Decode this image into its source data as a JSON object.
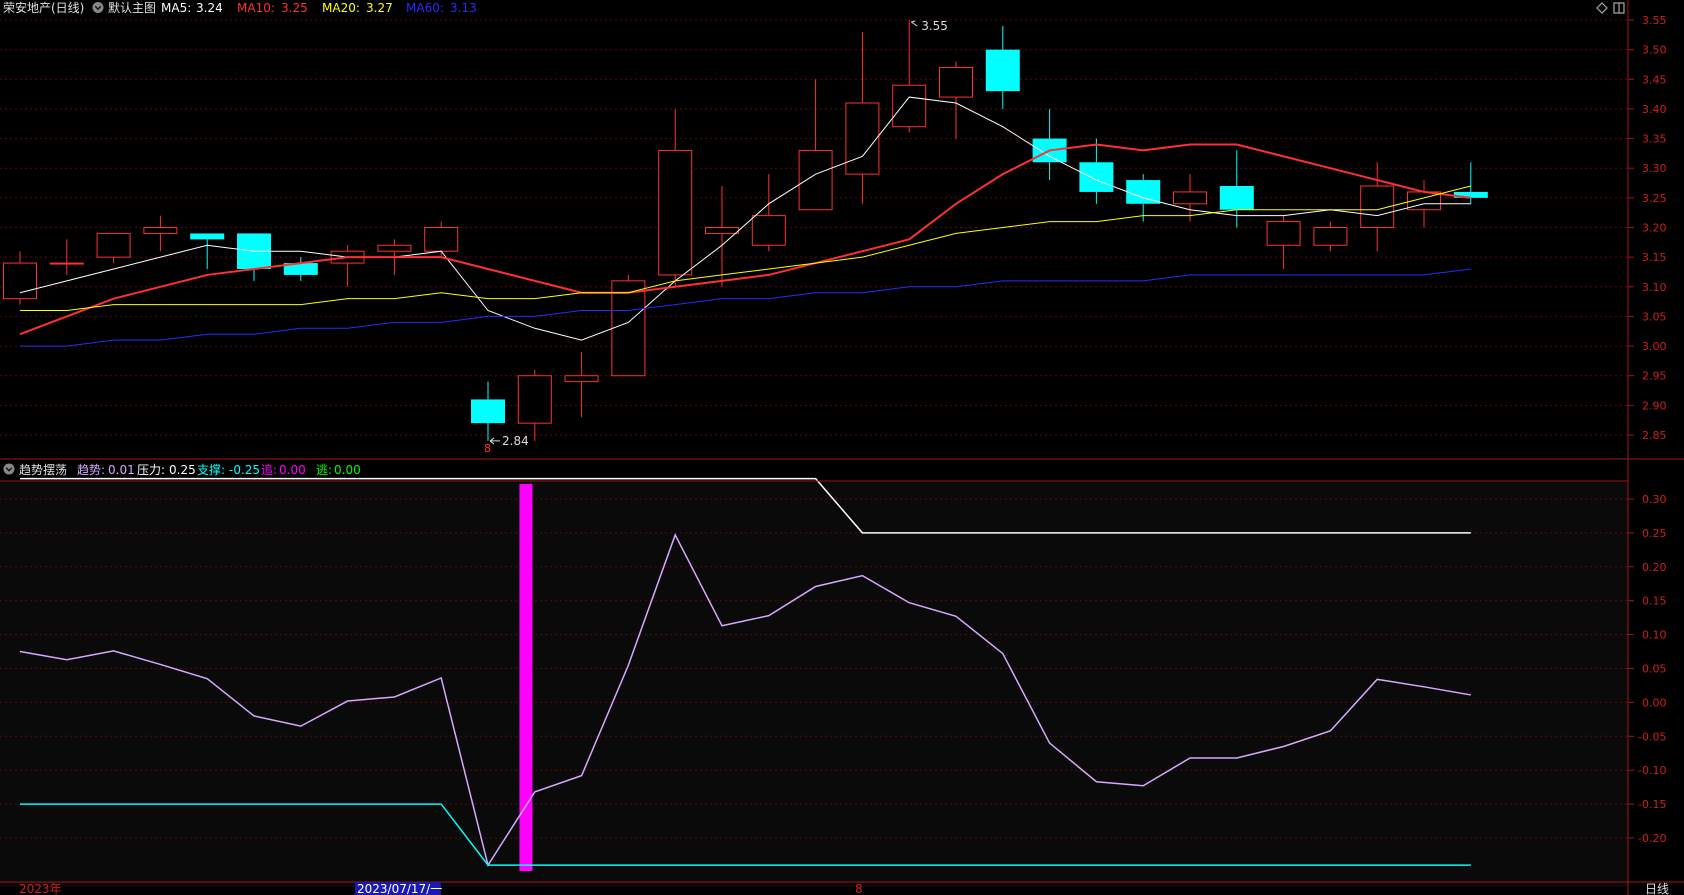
{
  "header": {
    "title": "荣安地产(日线)",
    "main_label": "默认主图",
    "ma": [
      {
        "label": "MA5:",
        "value": "3.24",
        "color": "#ffffff"
      },
      {
        "label": "MA10:",
        "value": "3.25",
        "color": "#ff3030"
      },
      {
        "label": "MA20:",
        "value": "3.27",
        "color": "#ffff00"
      },
      {
        "label": "MA60:",
        "value": "3.13",
        "color": "#2a2aff"
      }
    ]
  },
  "sub_header": {
    "title": "趋势摆荡",
    "items": [
      {
        "label": "趋势:",
        "value": "0.01",
        "color": "#d7a8ff"
      },
      {
        "label": "压力:",
        "value": "0.25",
        "color": "#ffffff"
      },
      {
        "label": "支撑:",
        "value": "-0.25",
        "color": "#00ffff"
      },
      {
        "label": "追:",
        "value": "0.00",
        "color": "#ff00ff"
      },
      {
        "label": "逃:",
        "value": "0.00",
        "color": "#00ff00"
      }
    ]
  },
  "footer": {
    "left": "2023年",
    "date": "2023/07/17/一",
    "mid": "8",
    "right": "日线"
  },
  "chart_data": [
    {
      "type": "candlestick",
      "title": "荣安地产(日线)",
      "ylim": [
        2.82,
        3.57
      ],
      "y_ticks": [
        "3.55",
        "3.50",
        "3.45",
        "3.40",
        "3.35",
        "3.30",
        "3.25",
        "3.20",
        "3.15",
        "3.10",
        "3.05",
        "3.00",
        "2.95",
        "2.90",
        "2.85"
      ],
      "high_annotation": "3.55",
      "low_annotation": "2.84",
      "low_marker": "8",
      "candles": [
        {
          "o": 3.08,
          "h": 3.16,
          "l": 3.07,
          "c": 3.14
        },
        {
          "o": 3.14,
          "h": 3.18,
          "l": 3.12,
          "c": 3.14
        },
        {
          "o": 3.15,
          "h": 3.19,
          "l": 3.14,
          "c": 3.19
        },
        {
          "o": 3.19,
          "h": 3.22,
          "l": 3.16,
          "c": 3.2
        },
        {
          "o": 3.19,
          "h": 3.19,
          "l": 3.13,
          "c": 3.18
        },
        {
          "o": 3.19,
          "h": 3.19,
          "l": 3.11,
          "c": 3.13
        },
        {
          "o": 3.14,
          "h": 3.15,
          "l": 3.11,
          "c": 3.12
        },
        {
          "o": 3.14,
          "h": 3.17,
          "l": 3.1,
          "c": 3.16
        },
        {
          "o": 3.16,
          "h": 3.18,
          "l": 3.12,
          "c": 3.17
        },
        {
          "o": 3.16,
          "h": 3.21,
          "l": 3.15,
          "c": 3.2
        },
        {
          "o": 2.91,
          "h": 2.94,
          "l": 2.84,
          "c": 2.87
        },
        {
          "o": 2.87,
          "h": 2.96,
          "l": 2.84,
          "c": 2.95
        },
        {
          "o": 2.94,
          "h": 2.99,
          "l": 2.88,
          "c": 2.95
        },
        {
          "o": 2.95,
          "h": 3.12,
          "l": 2.95,
          "c": 3.11
        },
        {
          "o": 3.12,
          "h": 3.4,
          "l": 3.1,
          "c": 3.33
        },
        {
          "o": 3.19,
          "h": 3.27,
          "l": 3.1,
          "c": 3.2
        },
        {
          "o": 3.17,
          "h": 3.29,
          "l": 3.16,
          "c": 3.22
        },
        {
          "o": 3.23,
          "h": 3.45,
          "l": 3.23,
          "c": 3.33
        },
        {
          "o": 3.29,
          "h": 3.53,
          "l": 3.24,
          "c": 3.41
        },
        {
          "o": 3.37,
          "h": 3.55,
          "l": 3.36,
          "c": 3.44
        },
        {
          "o": 3.42,
          "h": 3.48,
          "l": 3.35,
          "c": 3.47
        },
        {
          "o": 3.5,
          "h": 3.54,
          "l": 3.4,
          "c": 3.43
        },
        {
          "o": 3.35,
          "h": 3.4,
          "l": 3.28,
          "c": 3.31
        },
        {
          "o": 3.31,
          "h": 3.35,
          "l": 3.24,
          "c": 3.26
        },
        {
          "o": 3.28,
          "h": 3.29,
          "l": 3.21,
          "c": 3.24
        },
        {
          "o": 3.24,
          "h": 3.29,
          "l": 3.21,
          "c": 3.26
        },
        {
          "o": 3.27,
          "h": 3.33,
          "l": 3.2,
          "c": 3.23
        },
        {
          "o": 3.17,
          "h": 3.22,
          "l": 3.13,
          "c": 3.21
        },
        {
          "o": 3.17,
          "h": 3.21,
          "l": 3.16,
          "c": 3.2
        },
        {
          "o": 3.2,
          "h": 3.31,
          "l": 3.16,
          "c": 3.27
        },
        {
          "o": 3.23,
          "h": 3.28,
          "l": 3.2,
          "c": 3.26
        },
        {
          "o": 3.26,
          "h": 3.31,
          "l": 3.24,
          "c": 3.25
        }
      ],
      "series": [
        {
          "name": "MA5",
          "color": "#ffffff",
          "width": 1,
          "values": [
            3.09,
            3.11,
            3.13,
            3.15,
            3.17,
            3.16,
            3.16,
            3.15,
            3.15,
            3.16,
            3.06,
            3.03,
            3.01,
            3.04,
            3.11,
            3.17,
            3.24,
            3.29,
            3.32,
            3.42,
            3.41,
            3.37,
            3.32,
            3.28,
            3.25,
            3.23,
            3.22,
            3.22,
            3.23,
            3.22,
            3.24,
            3.24
          ]
        },
        {
          "name": "MA10",
          "color": "#ff3030",
          "width": 2,
          "values": [
            3.02,
            3.05,
            3.08,
            3.1,
            3.12,
            3.13,
            3.14,
            3.15,
            3.15,
            3.15,
            3.13,
            3.11,
            3.09,
            3.09,
            3.1,
            3.11,
            3.12,
            3.14,
            3.16,
            3.18,
            3.24,
            3.29,
            3.33,
            3.34,
            3.33,
            3.34,
            3.34,
            3.32,
            3.3,
            3.28,
            3.26,
            3.25
          ]
        },
        {
          "name": "MA20",
          "color": "#ffff00",
          "width": 1,
          "values": [
            3.06,
            3.06,
            3.07,
            3.07,
            3.07,
            3.07,
            3.07,
            3.08,
            3.08,
            3.09,
            3.08,
            3.08,
            3.09,
            3.09,
            3.11,
            3.12,
            3.13,
            3.14,
            3.15,
            3.17,
            3.19,
            3.2,
            3.21,
            3.21,
            3.22,
            3.22,
            3.23,
            3.23,
            3.23,
            3.23,
            3.25,
            3.27
          ]
        },
        {
          "name": "MA60",
          "color": "#2a2aff",
          "width": 1,
          "values": [
            3.0,
            3.0,
            3.01,
            3.01,
            3.02,
            3.02,
            3.03,
            3.03,
            3.04,
            3.04,
            3.05,
            3.05,
            3.06,
            3.06,
            3.07,
            3.08,
            3.08,
            3.09,
            3.09,
            3.1,
            3.1,
            3.11,
            3.11,
            3.11,
            3.11,
            3.12,
            3.12,
            3.12,
            3.12,
            3.12,
            3.12,
            3.13
          ]
        }
      ]
    },
    {
      "type": "line",
      "title": "趋势摆荡",
      "ylim": [
        -0.245,
        0.33
      ],
      "y_ticks": [
        "0.30",
        "0.25",
        "0.20",
        "0.15",
        "0.10",
        "0.05",
        "0.00",
        "-0.05",
        "-0.10",
        "-0.15",
        "-0.20"
      ],
      "series": [
        {
          "name": "趋势",
          "color": "#d7a8ff",
          "values": [
            0.075,
            0.063,
            0.076,
            0.056,
            0.035,
            -0.02,
            -0.035,
            0.002,
            0.008,
            0.036,
            -0.24,
            -0.132,
            -0.108,
            0.055,
            0.247,
            0.113,
            0.128,
            0.171,
            0.187,
            0.147,
            0.127,
            0.072,
            -0.06,
            -0.117,
            -0.123,
            -0.082,
            -0.082,
            -0.065,
            -0.042,
            0.034,
            0.023,
            0.011
          ]
        },
        {
          "name": "压力",
          "color": "#ffffff",
          "values": [
            0.33,
            0.33,
            0.33,
            0.33,
            0.33,
            0.33,
            0.33,
            0.33,
            0.33,
            0.33,
            0.33,
            0.33,
            0.33,
            0.33,
            0.33,
            0.33,
            0.33,
            0.33,
            0.25,
            0.25,
            0.25,
            0.25,
            0.25,
            0.25,
            0.25,
            0.25,
            0.25,
            0.25,
            0.25,
            0.25,
            0.25,
            0.25
          ]
        },
        {
          "name": "支撑",
          "color": "#00ffff",
          "values": [
            -0.15,
            -0.15,
            -0.15,
            -0.15,
            -0.15,
            -0.15,
            -0.15,
            -0.15,
            -0.15,
            -0.15,
            -0.24,
            -0.24,
            -0.24,
            -0.24,
            -0.24,
            -0.24,
            -0.24,
            -0.24,
            -0.24,
            -0.24,
            -0.24,
            -0.24,
            -0.24,
            -0.24,
            -0.24,
            -0.24,
            -0.24,
            -0.24,
            -0.24,
            -0.24,
            -0.24,
            -0.24
          ]
        }
      ],
      "signal_bar": {
        "name": "追",
        "color": "#ff00ff",
        "index": 10.8
      }
    }
  ]
}
